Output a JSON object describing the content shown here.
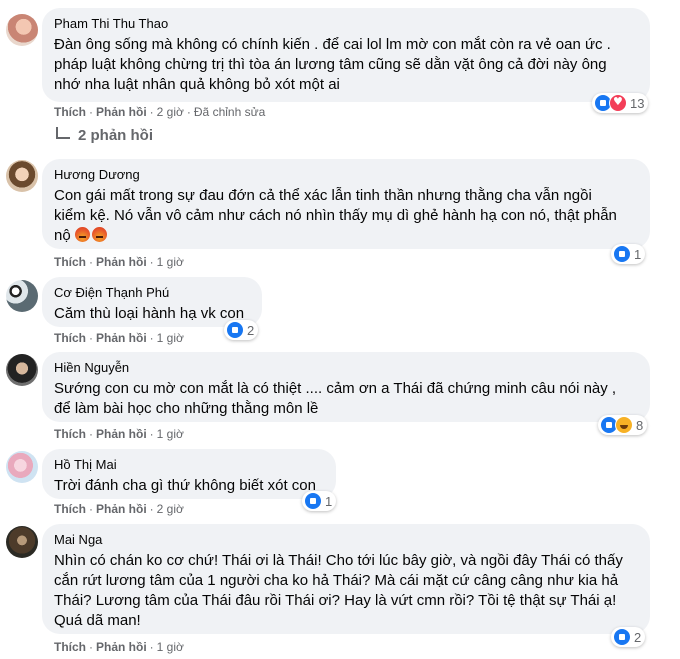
{
  "comments": [
    {
      "author": "Pham Thi Thu Thao",
      "lines": [
        "Đàn ông sống mà không có chính kiến . để cai lol lm mờ con mắt còn ra vẻ oan ức .",
        "pháp luật không chừng trị thì tòa án lương tâm cũng sẽ dằn vặt ông cả đời này ông",
        "nhớ nha luật nhân quả không bỏ xót một ai"
      ],
      "like": "Thích",
      "reply": "Phản hồi",
      "time": "2 giờ",
      "edited": "Đã chỉnh sửa",
      "reaction_count": "13",
      "reactions": [
        "like-icon",
        "love-icon"
      ]
    },
    {
      "author": "Hương Dương",
      "lines": [
        "Con gái mất trong sự đau đớn cả thể xác lẫn tinh thần nhưng thằng cha vẫn ngồi",
        "kiểm kệ. Nó vẫn vô cảm như cách nó nhìn thấy mụ dì ghẻ hành hạ con nó, thật phẫn",
        "nộ"
      ],
      "like": "Thích",
      "reply": "Phản hồi",
      "time": "1 giờ",
      "reaction_count": "1",
      "reactions": [
        "like-icon"
      ]
    },
    {
      "author": "Cơ Điện Thạnh Phú",
      "lines": [
        "Căm thù loại hành hạ vk con"
      ],
      "like": "Thích",
      "reply": "Phản hồi",
      "time": "1 giờ",
      "reaction_count": "2",
      "reactions": [
        "like-icon"
      ]
    },
    {
      "author": "Hiền Nguyễn",
      "lines": [
        "Sướng con cu mờ con mắt là có thiệt .... cảm ơn a Thái đã chứng minh câu nói này ,",
        "để làm bài học cho những thằng môn lề"
      ],
      "like": "Thích",
      "reply": "Phản hồi",
      "time": "1 giờ",
      "reaction_count": "8",
      "reactions": [
        "like-icon",
        "haha-icon"
      ]
    },
    {
      "author": "Hồ Thị Mai",
      "lines": [
        "Trời đánh cha gì thứ không biết xót con"
      ],
      "like": "Thích",
      "reply": "Phản hồi",
      "time": "2 giờ",
      "reaction_count": "1",
      "reactions": [
        "like-icon"
      ]
    },
    {
      "author": "Mai Nga",
      "lines": [
        "Nhìn có chán ko cơ chứ! Thái ơi là Thái! Cho tới lúc bây giờ, và ngồi đây Thái có thấy",
        "cắn rứt lương tâm của 1 người cha ko hả Thái? Mà cái mặt cứ câng câng như kia hả",
        "Thái? Lương tâm của Thái đâu rồi Thái ơi? Hay là vứt cmn rồi? Tồi tệ thật sự Thái ạ!",
        "Quá dã man!"
      ],
      "like": "Thích",
      "reply": "Phản hồi",
      "time": "1 giờ",
      "reaction_count": "2",
      "reactions": [
        "like-icon"
      ]
    }
  ],
  "replies_link": "2 phản hồi",
  "colors": {
    "bubble": "#f0f2f5",
    "meta": "#65676b",
    "like_blue": "#1877f2",
    "love_red": "#f33e58"
  }
}
